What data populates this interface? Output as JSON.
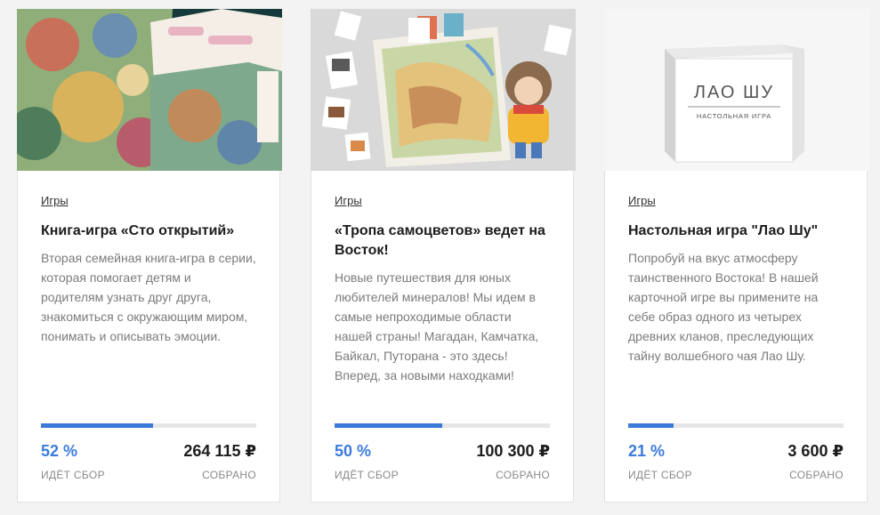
{
  "cards": [
    {
      "category": "Игры",
      "title": "Книга-игра «Сто открытий»",
      "description": "Вторая семейная книга-игра в серии, которая помогает детям и родителям узнать друг друга, знакомиться с окружающим миром, понимать и описывать эмоции.",
      "percent_label": "52 %",
      "progress": 0.52,
      "amount": "264 115 ₽",
      "status_label": "ИДЁТ СБОР",
      "collected_label": "СОБРАНО"
    },
    {
      "category": "Игры",
      "title": "«Тропа самоцветов» ведет на Восток!",
      "description": "Новые путешествия для юных любителей минералов! Мы идем в самые непроходимые области нашей страны! Магадан, Камчатка, Байкал, Путорана - это здесь! Вперед, за новыми находками!",
      "percent_label": "50 %",
      "progress": 0.5,
      "amount": "100 300 ₽",
      "status_label": "ИДЁТ СБОР",
      "collected_label": "СОБРАНО"
    },
    {
      "category": "Игры",
      "title": "Настольная игра \"Лао Шу\"",
      "description": "Попробуй на вкус атмосферу таинственного Востока! В нашей карточной игре вы примените на себе образ одного из четырех древних кланов, преследующих тайну волшебного чая Лао Шу.",
      "percent_label": "21 %",
      "progress": 0.21,
      "amount": "3 600 ₽",
      "status_label": "ИДЁТ СБОР",
      "collected_label": "СОБРАНО",
      "box_title": "ЛАО ШУ",
      "box_subtitle": "НАСТОЛЬНАЯ ИГРА"
    }
  ],
  "colors": {
    "accent": "#3b7bdc",
    "progress_track": "#e6e6e6"
  }
}
